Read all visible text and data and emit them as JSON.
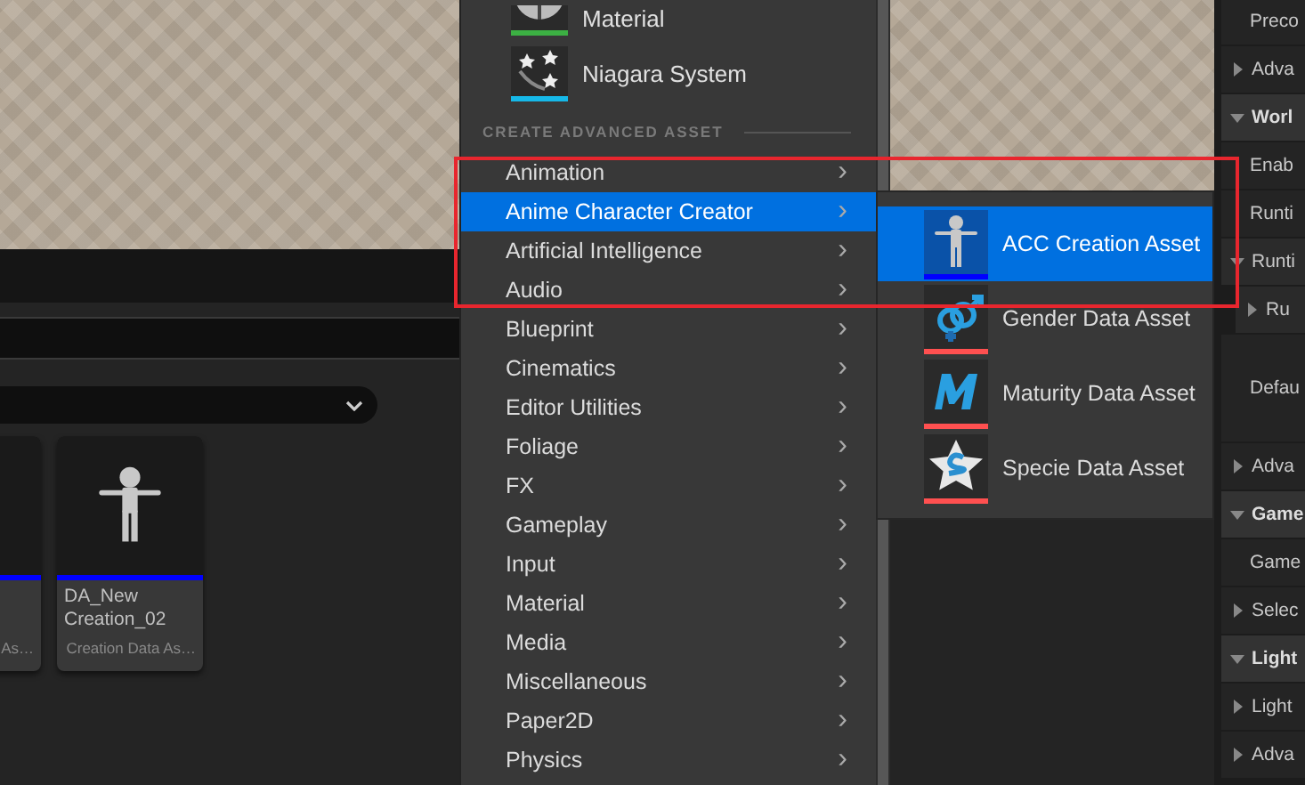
{
  "content_browser": {
    "assets": [
      {
        "type": "As…",
        "color": "#0000ff"
      },
      {
        "name": "DA_New Creation_02",
        "type": "Creation Data As…",
        "color": "#0000ff"
      }
    ]
  },
  "menu": {
    "featured": [
      {
        "label": "Material",
        "color": "#3cb043"
      },
      {
        "label": "Niagara System",
        "color": "#16b8e8"
      }
    ],
    "section": "CREATE ADVANCED ASSET",
    "categories": [
      {
        "label": "Animation",
        "selected": false,
        "chevron": "›"
      },
      {
        "label": "Anime Character Creator",
        "selected": true,
        "chevron": "›"
      },
      {
        "label": "Artificial Intelligence",
        "selected": false,
        "chevron": "›"
      },
      {
        "label": "Audio",
        "selected": false,
        "chevron": "›"
      },
      {
        "label": "Blueprint",
        "selected": false,
        "chevron": "›"
      },
      {
        "label": "Cinematics",
        "selected": false,
        "chevron": "›"
      },
      {
        "label": "Editor Utilities",
        "selected": false,
        "chevron": "›"
      },
      {
        "label": "Foliage",
        "selected": false,
        "chevron": "›"
      },
      {
        "label": "FX",
        "selected": false,
        "chevron": "›"
      },
      {
        "label": "Gameplay",
        "selected": false,
        "chevron": "›"
      },
      {
        "label": "Input",
        "selected": false,
        "chevron": "›"
      },
      {
        "label": "Material",
        "selected": false,
        "chevron": "›"
      },
      {
        "label": "Media",
        "selected": false,
        "chevron": "›"
      },
      {
        "label": "Miscellaneous",
        "selected": false,
        "chevron": "›"
      },
      {
        "label": "Paper2D",
        "selected": false,
        "chevron": "›"
      },
      {
        "label": "Physics",
        "selected": false,
        "chevron": "›"
      }
    ]
  },
  "submenu": {
    "items": [
      {
        "label": "ACC Creation Asset",
        "selected": true,
        "color": "#0000ff"
      },
      {
        "label": "Gender Data Asset",
        "selected": false,
        "color": "#ff5050"
      },
      {
        "label": "Maturity Data Asset",
        "selected": false,
        "color": "#ff5050"
      },
      {
        "label": "Specie Data Asset",
        "selected": false,
        "color": "#ff5050"
      }
    ]
  },
  "details": {
    "rows": [
      {
        "label": "Preco",
        "kind": "field"
      },
      {
        "label": "Adva",
        "kind": "group",
        "expanded": false
      },
      {
        "label": "Worl",
        "kind": "header",
        "expanded": true
      },
      {
        "label": "Enab",
        "kind": "field"
      },
      {
        "label": "Runti",
        "kind": "field"
      },
      {
        "label": "Runti",
        "kind": "group",
        "expanded": true
      },
      {
        "label": "Ru",
        "kind": "subgroup",
        "expanded": false
      },
      {
        "label": "Defau",
        "kind": "tall"
      },
      {
        "label": "Adva",
        "kind": "group",
        "expanded": false
      },
      {
        "label": "Game",
        "kind": "header",
        "expanded": true
      },
      {
        "label": "Game",
        "kind": "field"
      },
      {
        "label": "Selec",
        "kind": "group",
        "expanded": false
      },
      {
        "label": "Light",
        "kind": "header",
        "expanded": true
      },
      {
        "label": "Light",
        "kind": "group",
        "expanded": false
      },
      {
        "label": "Adva",
        "kind": "group",
        "expanded": false
      }
    ]
  }
}
